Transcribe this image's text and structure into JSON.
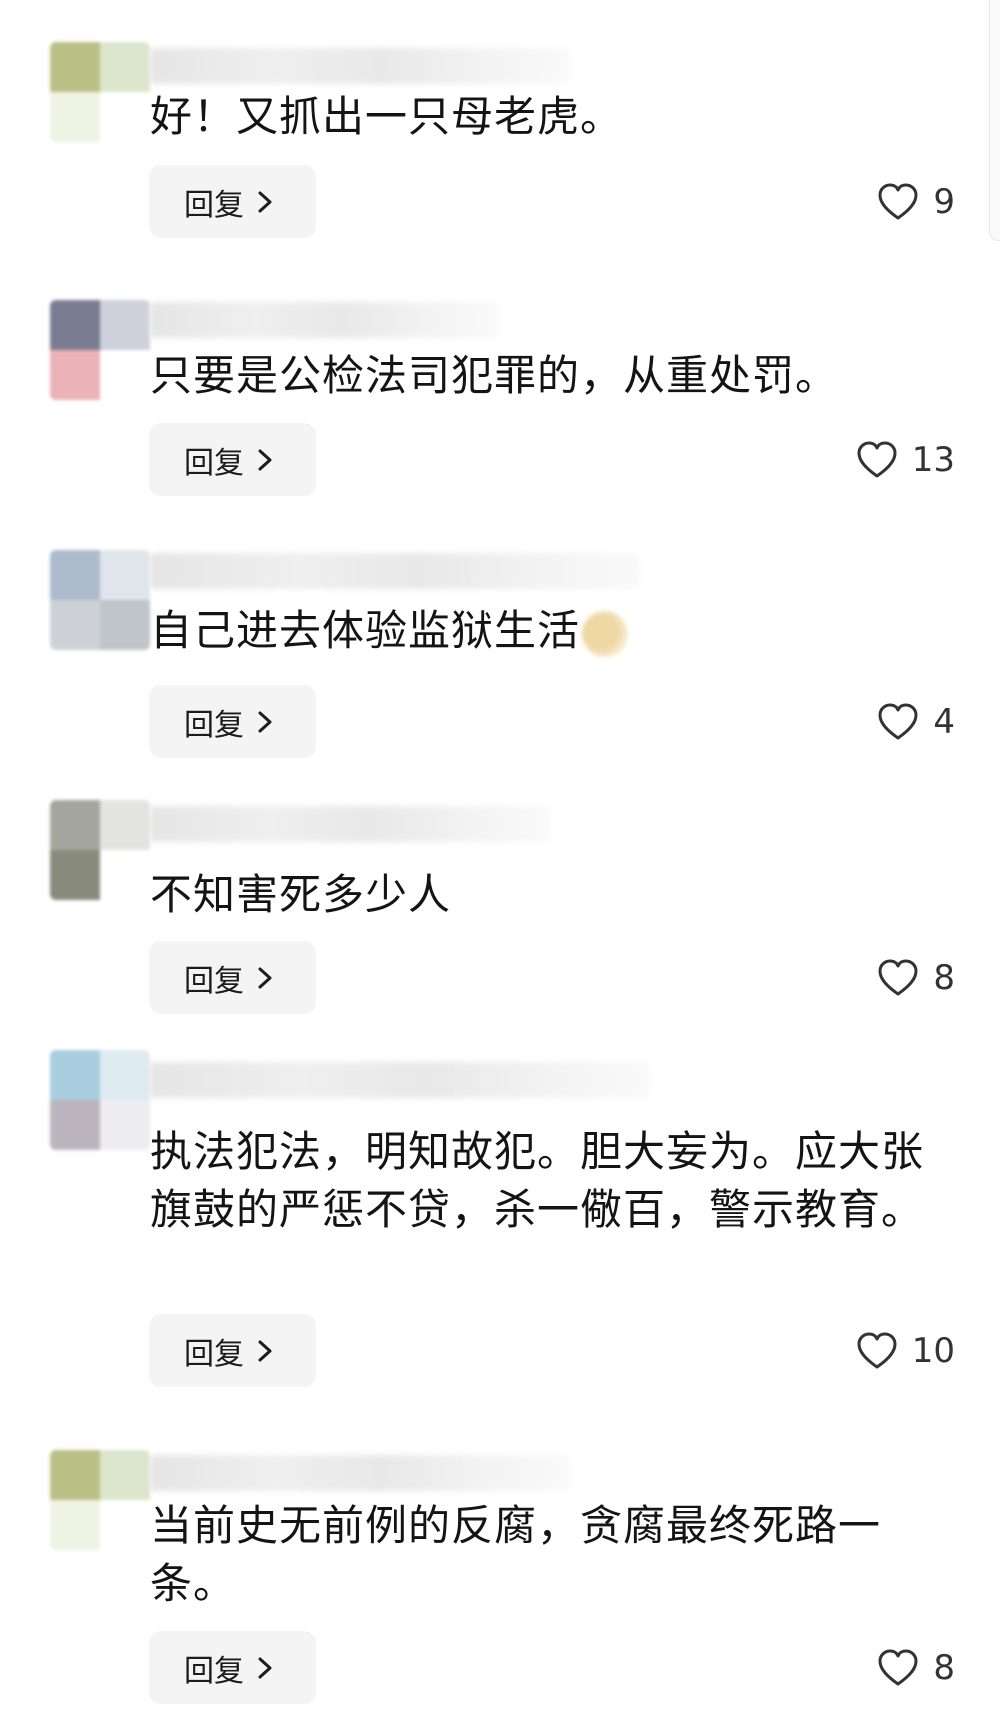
{
  "reply_label": "回复",
  "icons": {
    "chevron": "chevron-right-icon",
    "like": "heart-outline-icon"
  },
  "comments": [
    {
      "text": "好！又抓出一只母老虎。",
      "likes": "9"
    },
    {
      "text": "只要是公检法司犯罪的，从重处罚。",
      "likes": "13"
    },
    {
      "text": "自己进去体验监狱生活",
      "likes": "4",
      "trailing_emoji": true
    },
    {
      "text": "不知害死多少人",
      "likes": "8"
    },
    {
      "text": "执法犯法，明知故犯。胆大妄为。应大张旗鼓的严惩不贷，杀一儆百，警示教育。",
      "likes": "10"
    },
    {
      "text": "当前史无前例的反腐，贪腐最终死路一条。",
      "likes": "8"
    }
  ]
}
